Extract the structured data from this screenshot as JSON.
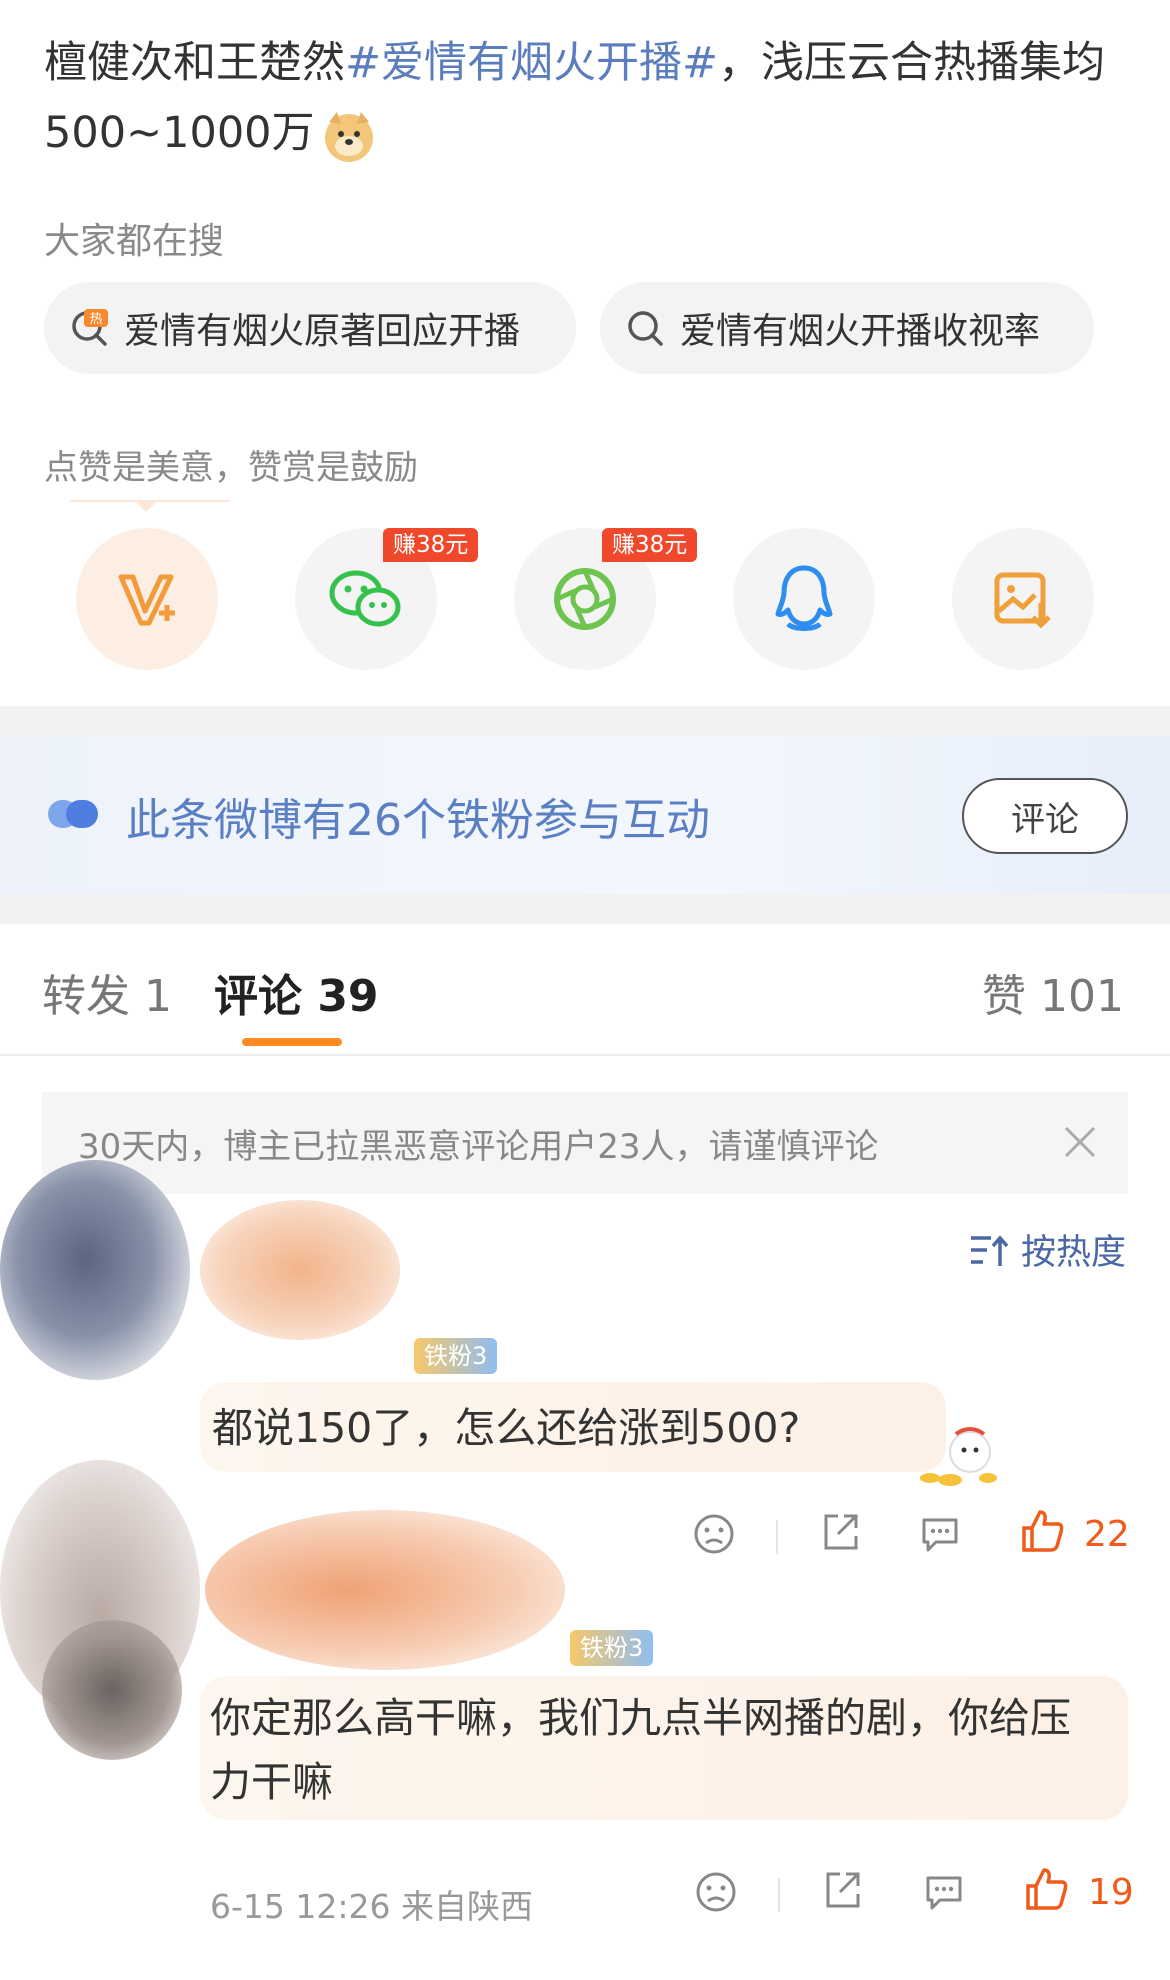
{
  "post": {
    "text_prefix": "檀健次和王楚然",
    "hashtag": "#爱情有烟火开播#",
    "text_suffix": "，浅压云合热播集均500~1000万"
  },
  "search": {
    "title": "大家都在搜",
    "chips": [
      {
        "label": "爱情有烟火原著回应开播",
        "icon": "hot-search-icon"
      },
      {
        "label": "爱情有烟火开播收视率",
        "icon": "search-icon"
      }
    ]
  },
  "reward": {
    "hint": "点赞是美意，赞赏是鼓励",
    "share_targets": [
      {
        "name": "vip-reward",
        "icon": "v-plus-icon"
      },
      {
        "name": "wechat",
        "icon": "wechat-icon",
        "badge": "赚38元"
      },
      {
        "name": "moments",
        "icon": "moments-icon",
        "badge": "赚38元"
      },
      {
        "name": "qq",
        "icon": "qq-icon"
      },
      {
        "name": "save-image",
        "icon": "save-image-icon"
      }
    ]
  },
  "fans_banner": {
    "text": "此条微博有26个铁粉参与互动",
    "button": "评论"
  },
  "tabs": {
    "repost": "转发 1",
    "comments": "评论 39",
    "likes": "赞 101"
  },
  "notice": "30天内，博主已拉黑恶意评论用户23人，请谨慎评论",
  "sort_label": "按热度",
  "comments": [
    {
      "fan_badge": "铁粉3",
      "text": "都说150了，怎么还给涨到500?",
      "likes": "22"
    },
    {
      "fan_badge": "铁粉3",
      "text": "你定那么高干嘛，我们九点半网播的剧，你给压力干嘛",
      "time_location": "6-15 12:26 来自陕西",
      "likes": "19"
    }
  ],
  "colors": {
    "accent_orange": "#ff8a20",
    "link_blue": "#5b7dbd",
    "badge_red": "#f0482a",
    "like_orange": "#f05a1a"
  }
}
